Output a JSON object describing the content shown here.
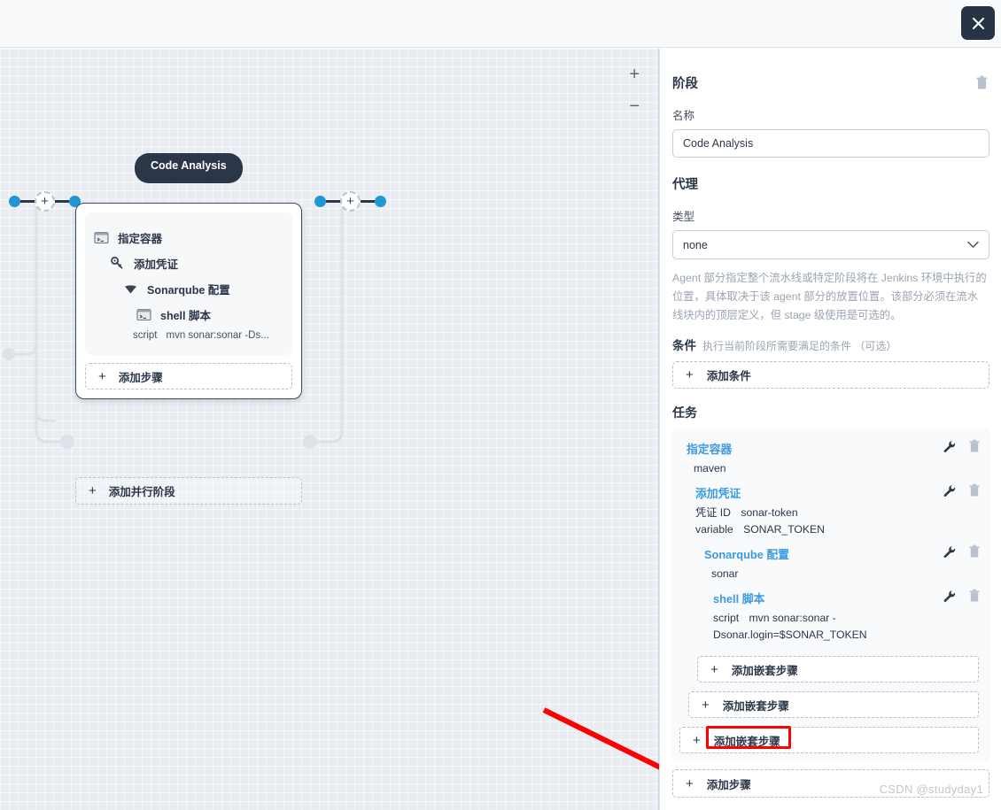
{
  "topbar": {
    "close_icon": "close-icon"
  },
  "canvas": {
    "zoom_in": "+",
    "zoom_out": "−",
    "stage_node": {
      "tab_label": "Code Analysis",
      "steps": [
        {
          "icon": "terminal-icon",
          "label": "指定容器",
          "level": 1
        },
        {
          "icon": "key-icon",
          "label": "添加凭证",
          "level": 2
        },
        {
          "icon": "sonarqube-icon",
          "label": "Sonarqube 配置",
          "level": 3
        },
        {
          "icon": "terminal-icon",
          "label": "shell 脚本",
          "level": 4
        }
      ],
      "script_key": "script",
      "script_value": "mvn sonar:sonar -Ds...",
      "add_step_label": "添加步骤"
    },
    "add_parallel_stage_label": "添加并行阶段"
  },
  "panel": {
    "title": "阶段",
    "delete_icon": "trash-icon",
    "name_label": "名称",
    "name_value": "Code Analysis",
    "agent_heading": "代理",
    "type_label": "类型",
    "type_value": "none",
    "agent_description": "Agent 部分指定整个流水线或特定阶段将在 Jenkins 环境中执行的位置，具体取决于该 agent 部分的放置位置。该部分必须在流水线块内的顶层定义，但 stage 级使用是可选的。",
    "condition_heading": "条件",
    "condition_hint": "执行当前阶段所需要满足的条件 （可选）",
    "add_condition_label": "添加条件",
    "tasks_heading": "任务",
    "tasks": [
      {
        "title": "指定容器",
        "indent": 0,
        "kv": [
          {
            "k": "maven",
            "v": ""
          }
        ]
      },
      {
        "title": "添加凭证",
        "indent": 1,
        "kv": [
          {
            "k": "凭证 ID",
            "v": "sonar-token"
          },
          {
            "k": "variable",
            "v": "SONAR_TOKEN"
          }
        ]
      },
      {
        "title": "Sonarqube 配置",
        "indent": 2,
        "kv": [
          {
            "k": "sonar",
            "v": ""
          }
        ]
      },
      {
        "title": "shell 脚本",
        "indent": 3,
        "kv": [
          {
            "k": "script",
            "v": "mvn sonar:sonar -Dsonar.login=$SONAR_TOKEN"
          }
        ]
      }
    ],
    "nested_buttons": [
      {
        "label": "添加嵌套步骤",
        "highlighted": false
      },
      {
        "label": "添加嵌套步骤",
        "highlighted": false
      },
      {
        "label": "添加嵌套步骤",
        "highlighted": true
      }
    ],
    "add_step_label": "添加步骤",
    "edit_icon": "wrench-icon",
    "delete_row_icon": "trash-icon"
  },
  "watermark": "CSDN @studyday1",
  "colors": {
    "accent_blue": "#3c9ade",
    "node_dark": "#2b3648",
    "connector_blue": "#2196d4",
    "highlight_red": "#ff0000",
    "canvas_bg": "#e9edf2"
  }
}
